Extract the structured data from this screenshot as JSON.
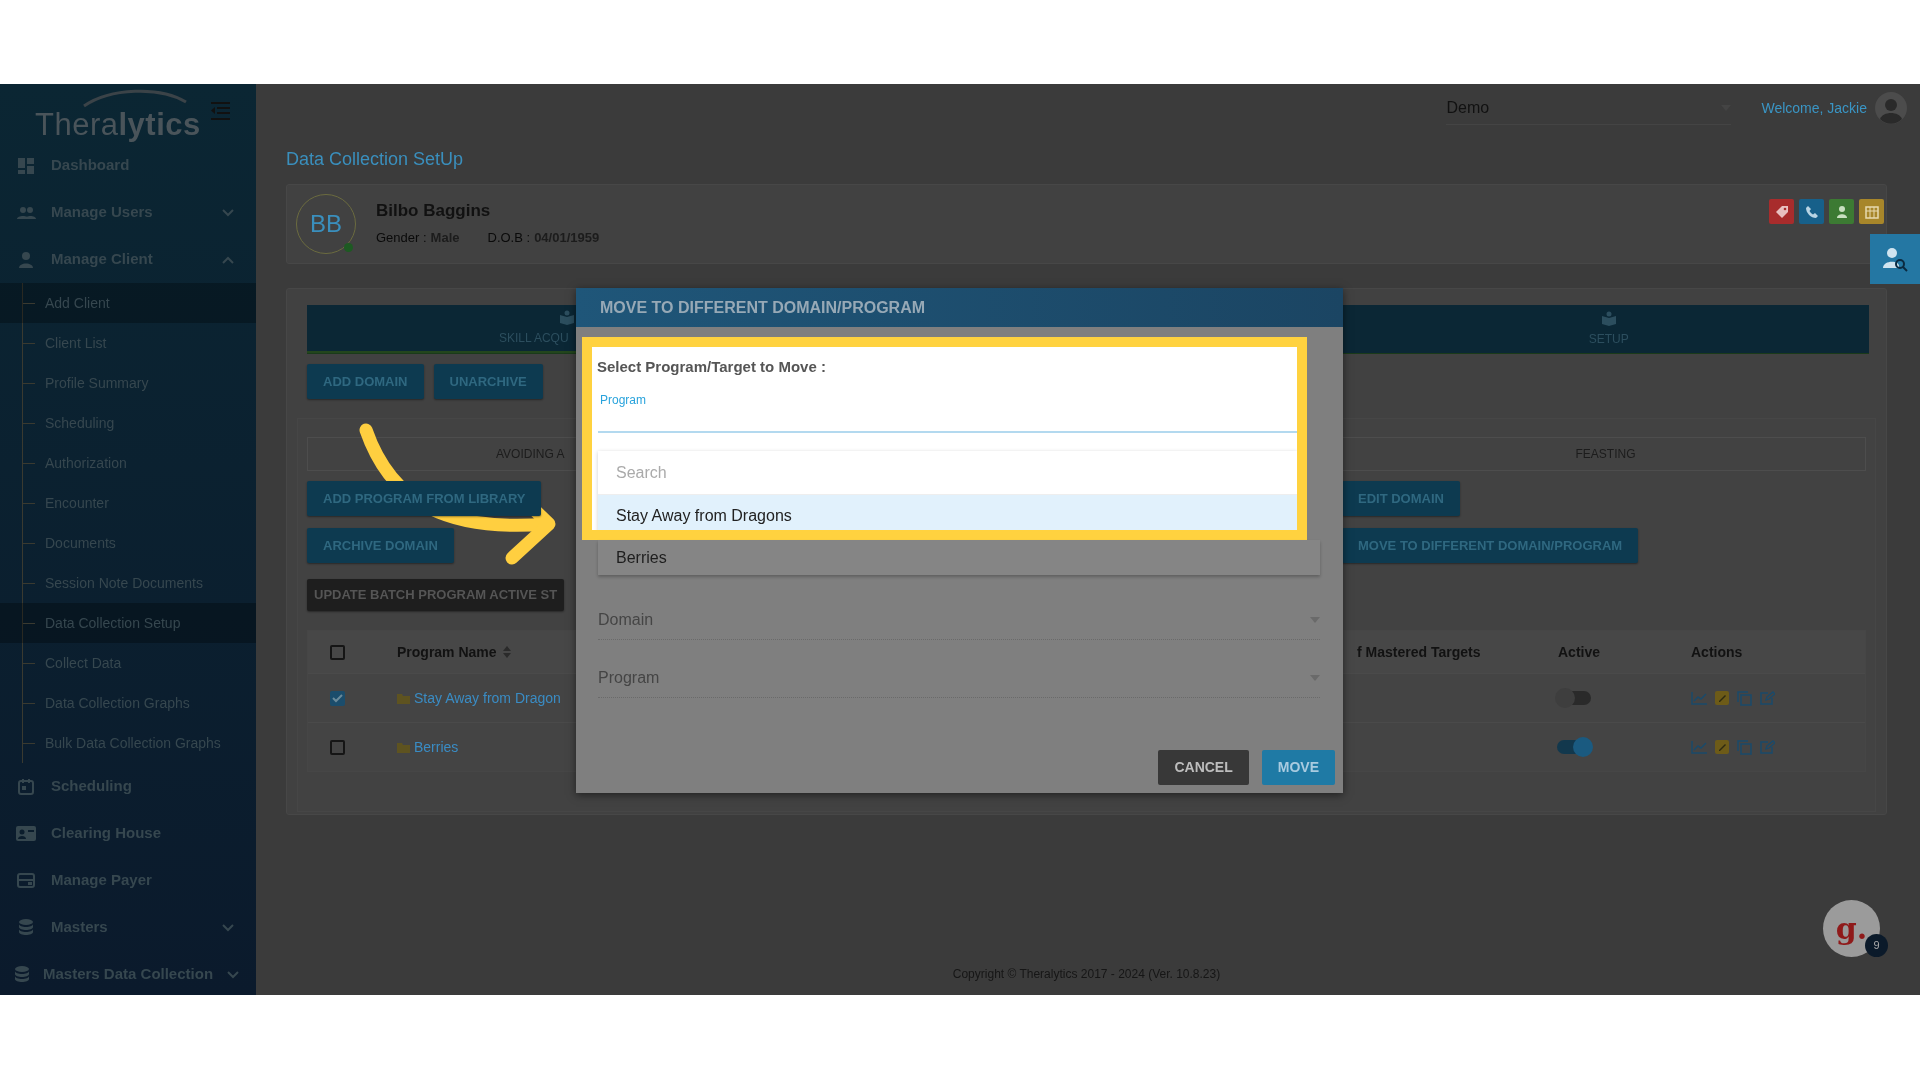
{
  "sidebar": {
    "logo": {
      "light": "Thera",
      "bold": "lytics"
    },
    "items": [
      {
        "label": "Dashboard"
      },
      {
        "label": "Manage Users",
        "expanded": false
      },
      {
        "label": "Manage Client",
        "expanded": true,
        "children": [
          {
            "label": "Add Client",
            "selected": true
          },
          {
            "label": "Client List",
            "selected": false
          },
          {
            "label": "Profile Summary",
            "selected": false
          },
          {
            "label": "Scheduling",
            "selected": false
          },
          {
            "label": "Authorization",
            "selected": false
          },
          {
            "label": "Encounter",
            "selected": false
          },
          {
            "label": "Documents",
            "selected": false
          },
          {
            "label": "Session Note Documents",
            "selected": false
          },
          {
            "label": "Data Collection Setup",
            "selected": true
          },
          {
            "label": "Collect Data",
            "selected": false
          },
          {
            "label": "Data Collection Graphs",
            "selected": false
          },
          {
            "label": "Bulk Data Collection Graphs",
            "selected": false
          }
        ]
      },
      {
        "label": "Scheduling"
      },
      {
        "label": "Clearing House"
      },
      {
        "label": "Manage Payer"
      },
      {
        "label": "Masters",
        "expanded": false
      },
      {
        "label": "Masters Data Collection",
        "expanded": false
      }
    ]
  },
  "topbar": {
    "org_select": "Demo",
    "welcome": "Welcome, Jackie"
  },
  "page_title": "Data Collection SetUp",
  "client": {
    "initials": "BB",
    "online": true,
    "name": "Bilbo Baggins",
    "gender_label": "Gender :",
    "gender": "Male",
    "dob_label": "D.O.B :",
    "dob": "04/01/1959"
  },
  "main_tabs": [
    {
      "label": "SKILL ACQU",
      "selected": true
    },
    {
      "label": "SETUP",
      "selected": false
    }
  ],
  "toolbar_buttons": [
    "ADD DOMAIN",
    "UNARCHIVE"
  ],
  "domain_tabs": [
    "AVOIDING A",
    "FEASTING"
  ],
  "domain_actions_left": [
    "ADD PROGRAM FROM LIBRARY",
    "ARCHIVE DOMAIN"
  ],
  "domain_actions_right": [
    "EDIT DOMAIN",
    "MOVE TO DIFFERENT DOMAIN/PROGRAM"
  ],
  "batch_button": "UPDATE BATCH PROGRAM ACTIVE ST",
  "table": {
    "all_checked": false,
    "columns": [
      "Program Name",
      "f Mastered Targets",
      "Active",
      "Actions"
    ],
    "rows": [
      {
        "checked": true,
        "name": "Stay Away from Dragon",
        "active": false
      },
      {
        "checked": false,
        "name": "Berries",
        "active": true
      }
    ]
  },
  "footer": "Copyright © Theralytics 2017 - 2024 (Ver. 10.8.23)",
  "chat": {
    "logo": "g.",
    "badge": "9"
  },
  "modal": {
    "title": "MOVE TO DIFFERENT DOMAIN/PROGRAM",
    "heading": "Select Program/Target to Move :",
    "program_label": "Program",
    "search": {
      "placeholder": "Search"
    },
    "options": [
      {
        "label": "Stay Away from Dragons",
        "selected": true
      },
      {
        "label": "Berries",
        "selected": false
      }
    ],
    "fields": [
      {
        "placeholder": "Domain"
      },
      {
        "placeholder": "Program"
      }
    ],
    "buttons": [
      {
        "label": "CANCEL",
        "kind": "secondary"
      },
      {
        "label": "MOVE",
        "kind": "primary"
      }
    ]
  }
}
